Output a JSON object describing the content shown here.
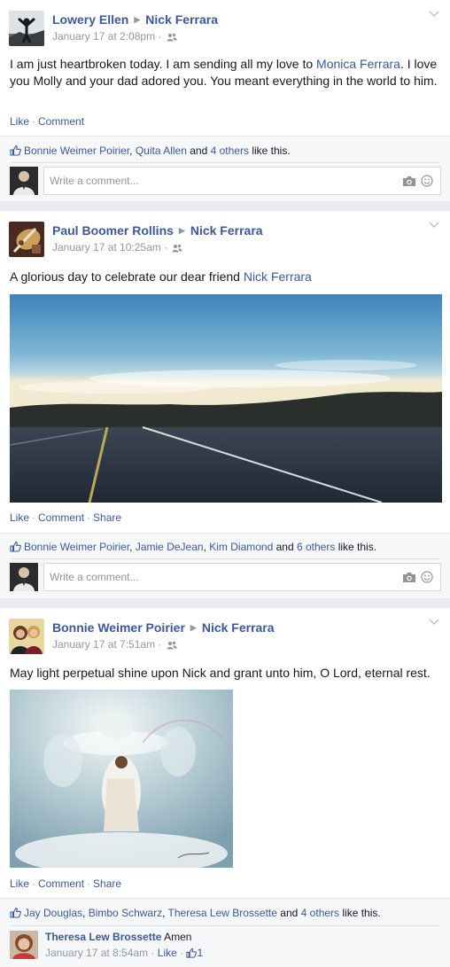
{
  "posts": [
    {
      "author": "Lowery Ellen",
      "target": "Nick Ferrara",
      "time": "January 17 at 2:08pm",
      "text_before": "I am just heartbroken today. I am sending all my love to ",
      "text_link": "Monica Ferrara",
      "text_after": ". I love you Molly and your dad adored you. You meant everything in the world to him.",
      "actions": [
        "Like",
        "Comment"
      ],
      "likers": [
        "Bonnie Weimer Poirier",
        "Quita Allen"
      ],
      "likes_others": "4 others",
      "comment_placeholder": "Write a comment..."
    },
    {
      "author": "Paul Boomer Rollins",
      "target": "Nick Ferrara",
      "time": "January 17 at 10:25am",
      "text_before": "A glorious day to celebrate our dear friend ",
      "text_link": "Nick Ferrara",
      "actions": [
        "Like",
        "Comment",
        "Share"
      ],
      "likers": [
        "Bonnie Weimer Poirier",
        "Jamie DeJean",
        "Kim Diamond"
      ],
      "likes_others": "6 others",
      "comment_placeholder": "Write a comment..."
    },
    {
      "author": "Bonnie Weimer Poirier",
      "target": "Nick Ferrara",
      "time": "January 17 at 7:51am",
      "text": "May light perpetual shine upon Nick and grant unto him, O Lord, eternal rest.",
      "actions": [
        "Like",
        "Comment",
        "Share"
      ],
      "likers": [
        "Jay Douglas",
        "Bimbo Schwarz",
        "Theresa Lew Brossette"
      ],
      "likes_others": "4 others",
      "comment": {
        "author": "Theresa Lew Brossette",
        "text": "Amen",
        "time": "January 17 at 8:54am",
        "like_label": "Like",
        "like_count": "1"
      }
    }
  ],
  "labels": {
    "and": "and",
    "like_this": "like this.",
    "comma": ", ",
    "dot": "·"
  },
  "colors": {
    "link": "#3b5998",
    "muted": "#9197a3",
    "ufi_bg": "#f6f7f8"
  }
}
